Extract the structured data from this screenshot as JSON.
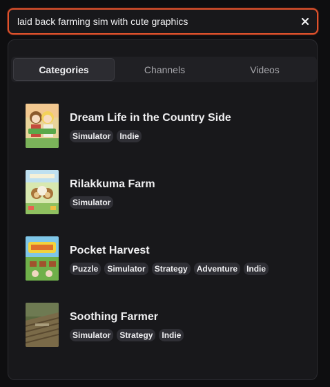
{
  "search": {
    "value": "laid back farming sim with cute graphics"
  },
  "tabs": [
    {
      "label": "Categories",
      "active": true
    },
    {
      "label": "Channels",
      "active": false
    },
    {
      "label": "Videos",
      "active": false
    }
  ],
  "results": [
    {
      "title": "Dream Life in the Country Side",
      "tags": [
        "Simulator",
        "Indie"
      ]
    },
    {
      "title": "Rilakkuma Farm",
      "tags": [
        "Simulator"
      ]
    },
    {
      "title": "Pocket Harvest",
      "tags": [
        "Puzzle",
        "Simulator",
        "Strategy",
        "Adventure",
        "Indie"
      ]
    },
    {
      "title": "Soothing Farmer",
      "tags": [
        "Simulator",
        "Strategy",
        "Indie"
      ]
    }
  ],
  "colors": {
    "accent": "#e0522d",
    "panel": "#18181b",
    "tag_bg": "#2f2f35"
  }
}
